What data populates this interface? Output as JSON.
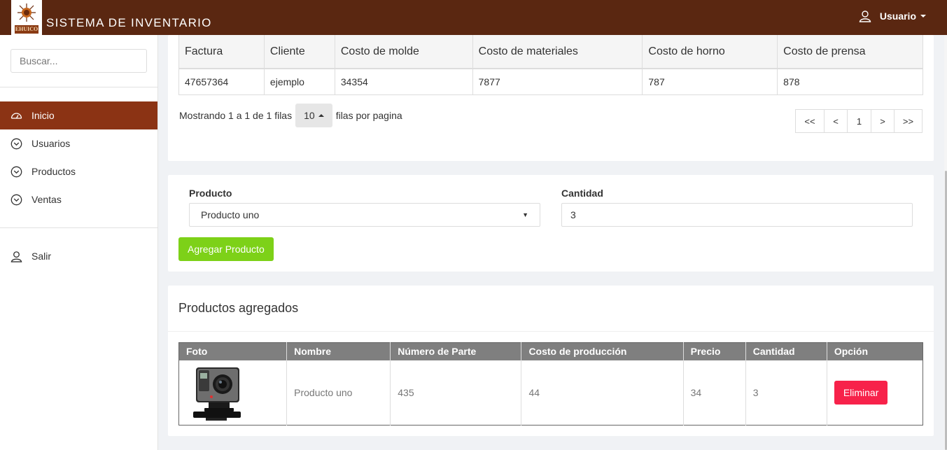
{
  "app": {
    "title": "SISTEMA DE INVENTARIO",
    "logo_text": "EHUICO"
  },
  "user_menu": {
    "label": "Usuario"
  },
  "sidebar": {
    "search_placeholder": "Buscar...",
    "items": [
      {
        "label": "Inicio",
        "active": true
      },
      {
        "label": "Usuarios"
      },
      {
        "label": "Productos"
      },
      {
        "label": "Ventas"
      }
    ],
    "logout_label": "Salir"
  },
  "invoice_table": {
    "headers": [
      "Factura",
      "Cliente",
      "Costo de molde",
      "Costo de materiales",
      "Costo de horno",
      "Costo de prensa"
    ],
    "rows": [
      [
        "47657364",
        "ejemplo",
        "34354",
        "7877",
        "787",
        "878"
      ]
    ],
    "pagination": {
      "showing_text": "Mostrando 1 a 1 de 1 filas",
      "page_size": "10",
      "per_page_text": "filas por pagina",
      "pages": [
        "<<",
        "<",
        "1",
        ">",
        ">>"
      ]
    }
  },
  "add_form": {
    "product_label": "Producto",
    "product_selected": "Producto uno",
    "quantity_label": "Cantidad",
    "quantity_value": "3",
    "add_button": "Agregar Producto"
  },
  "added_products": {
    "title": "Productos agregados",
    "headers": [
      "Foto",
      "Nombre",
      "Número de Parte",
      "Costo de producción",
      "Precio",
      "Cantidad",
      "Opción"
    ],
    "rows": [
      {
        "photo": "camera-image",
        "name": "Producto uno",
        "part_number": "435",
        "production_cost": "44",
        "price": "34",
        "quantity": "3",
        "action": "Eliminar"
      }
    ]
  },
  "colors": {
    "topbar": "#5a2711",
    "active_nav": "#8b3314",
    "add_button": "#7dd118",
    "delete_button": "#f7224a"
  }
}
